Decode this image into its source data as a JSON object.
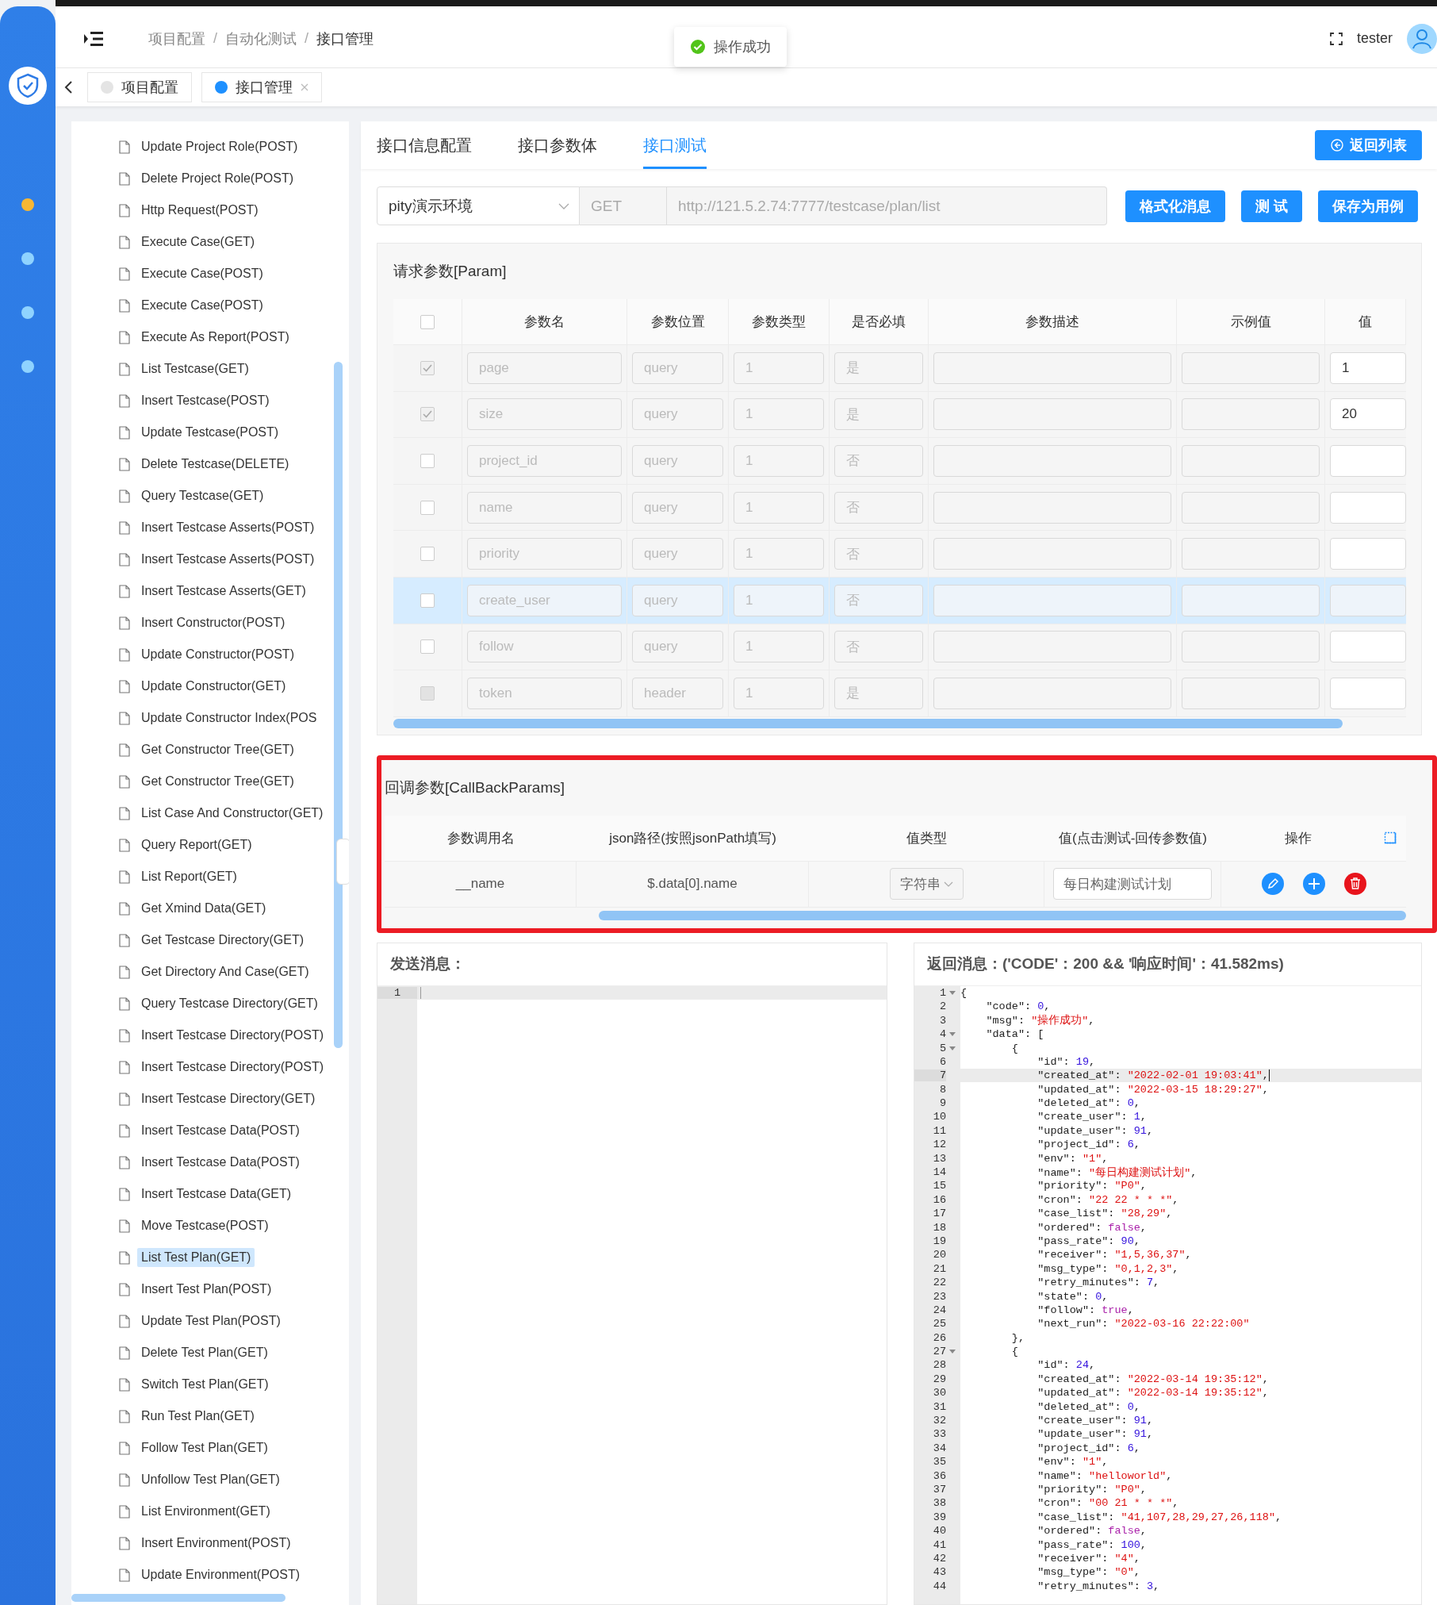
{
  "rail": {
    "items": [
      {
        "color": "#f7b733"
      },
      {
        "color": "#8fd3ff"
      },
      {
        "color": "#8fd3ff"
      },
      {
        "color": "#8fd3ff"
      }
    ]
  },
  "header": {
    "breadcrumb": [
      "项目配置",
      "自动化测试",
      "接口管理"
    ],
    "separator": "/",
    "toast": "操作成功",
    "user": "tester"
  },
  "tags": [
    {
      "label": "项目配置",
      "selected": false
    },
    {
      "label": "接口管理",
      "selected": true
    }
  ],
  "sidebar": {
    "items": [
      {
        "label": "Update Project Role(POST)",
        "selected": false
      },
      {
        "label": "Delete Project Role(POST)",
        "selected": false
      },
      {
        "label": "Http Request(POST)",
        "selected": false
      },
      {
        "label": "Execute Case(GET)",
        "selected": false
      },
      {
        "label": "Execute Case(POST)",
        "selected": false
      },
      {
        "label": "Execute Case(POST)",
        "selected": false
      },
      {
        "label": "Execute As Report(POST)",
        "selected": false
      },
      {
        "label": "List Testcase(GET)",
        "selected": false
      },
      {
        "label": "Insert Testcase(POST)",
        "selected": false
      },
      {
        "label": "Update Testcase(POST)",
        "selected": false
      },
      {
        "label": "Delete Testcase(DELETE)",
        "selected": false
      },
      {
        "label": "Query Testcase(GET)",
        "selected": false
      },
      {
        "label": "Insert Testcase Asserts(POST)",
        "selected": false
      },
      {
        "label": "Insert Testcase Asserts(POST)",
        "selected": false
      },
      {
        "label": "Insert Testcase Asserts(GET)",
        "selected": false
      },
      {
        "label": "Insert Constructor(POST)",
        "selected": false
      },
      {
        "label": "Update Constructor(POST)",
        "selected": false
      },
      {
        "label": "Update Constructor(GET)",
        "selected": false
      },
      {
        "label": "Update Constructor Index(POS",
        "selected": false
      },
      {
        "label": "Get Constructor Tree(GET)",
        "selected": false
      },
      {
        "label": "Get Constructor Tree(GET)",
        "selected": false
      },
      {
        "label": "List Case And Constructor(GET)",
        "selected": false
      },
      {
        "label": "Query Report(GET)",
        "selected": false
      },
      {
        "label": "List Report(GET)",
        "selected": false
      },
      {
        "label": "Get Xmind Data(GET)",
        "selected": false
      },
      {
        "label": "Get Testcase Directory(GET)",
        "selected": false
      },
      {
        "label": "Get Directory And Case(GET)",
        "selected": false
      },
      {
        "label": "Query Testcase Directory(GET)",
        "selected": false
      },
      {
        "label": "Insert Testcase Directory(POST)",
        "selected": false
      },
      {
        "label": "Insert Testcase Directory(POST)",
        "selected": false
      },
      {
        "label": "Insert Testcase Directory(GET)",
        "selected": false
      },
      {
        "label": "Insert Testcase Data(POST)",
        "selected": false
      },
      {
        "label": "Insert Testcase Data(POST)",
        "selected": false
      },
      {
        "label": "Insert Testcase Data(GET)",
        "selected": false
      },
      {
        "label": "Move Testcase(POST)",
        "selected": false
      },
      {
        "label": "List Test Plan(GET)",
        "selected": true
      },
      {
        "label": "Insert Test Plan(POST)",
        "selected": false
      },
      {
        "label": "Update Test Plan(POST)",
        "selected": false
      },
      {
        "label": "Delete Test Plan(GET)",
        "selected": false
      },
      {
        "label": "Switch Test Plan(GET)",
        "selected": false
      },
      {
        "label": "Run Test Plan(GET)",
        "selected": false
      },
      {
        "label": "Follow Test Plan(GET)",
        "selected": false
      },
      {
        "label": "Unfollow Test Plan(GET)",
        "selected": false
      },
      {
        "label": "List Environment(GET)",
        "selected": false
      },
      {
        "label": "Insert Environment(POST)",
        "selected": false
      },
      {
        "label": "Update Environment(POST)",
        "selected": false
      }
    ]
  },
  "tabs": [
    {
      "label": "接口信息配置",
      "selected": false
    },
    {
      "label": "接口参数体",
      "selected": false
    },
    {
      "label": "接口测试",
      "selected": true
    }
  ],
  "back_button": "返回列表",
  "request": {
    "env": "pity演示环境",
    "method": "GET",
    "url": "http://121.5.2.74:7777/testcase/plan/list",
    "buttons": [
      "格式化消息",
      "测 试",
      "保存为用例"
    ]
  },
  "params": {
    "title": "请求参数[Param]",
    "header_checked": false,
    "columns": [
      "参数名",
      "参数位置",
      "参数类型",
      "是否必填",
      "参数描述",
      "示例值",
      "值"
    ],
    "rows": [
      {
        "checked": true,
        "disabled": false,
        "hovered": false,
        "name": "page",
        "location": "query",
        "type": "1",
        "required": "是",
        "value": "1"
      },
      {
        "checked": true,
        "disabled": false,
        "hovered": false,
        "name": "size",
        "location": "query",
        "type": "1",
        "required": "是",
        "value": "20"
      },
      {
        "checked": false,
        "disabled": false,
        "hovered": false,
        "name": "project_id",
        "location": "query",
        "type": "1",
        "required": "否"
      },
      {
        "checked": false,
        "disabled": false,
        "hovered": false,
        "name": "name",
        "location": "query",
        "type": "1",
        "required": "否"
      },
      {
        "checked": false,
        "disabled": false,
        "hovered": false,
        "name": "priority",
        "location": "query",
        "type": "1",
        "required": "否"
      },
      {
        "checked": false,
        "disabled": false,
        "hovered": true,
        "name": "create_user",
        "location": "query",
        "type": "1",
        "required": "否"
      },
      {
        "checked": false,
        "disabled": false,
        "hovered": false,
        "name": "follow",
        "location": "query",
        "type": "1",
        "required": "否"
      },
      {
        "checked": false,
        "disabled": true,
        "hovered": false,
        "name": "token",
        "location": "header",
        "type": "1",
        "required": "是"
      }
    ]
  },
  "callback": {
    "title": "回调参数[CallBackParams]",
    "columns": [
      "参数调用名",
      "json路径(按照jsonPath填写)",
      "值类型",
      "值(点击测试-回传参数值)",
      "操作"
    ],
    "rows": [
      {
        "name": "__name",
        "path": "$.data[0].name",
        "type": "字符串",
        "value": "每日构建测试计划"
      }
    ]
  },
  "send": {
    "title": "发送消息：",
    "lines": [
      "1"
    ]
  },
  "response": {
    "title": "返回消息：('CODE'：200 && '响应时间'：41.582ms)",
    "lines": [
      {
        "n": "1",
        "fold": true,
        "current": false,
        "parts": [
          {
            "kind": "plain",
            "text": "{"
          }
        ]
      },
      {
        "n": "2",
        "fold": false,
        "current": false,
        "parts": [
          {
            "kind": "plain",
            "text": "    \"code\": "
          },
          {
            "kind": "number",
            "text": "0"
          },
          {
            "kind": "plain",
            "text": ","
          }
        ]
      },
      {
        "n": "3",
        "fold": false,
        "current": false,
        "parts": [
          {
            "kind": "plain",
            "text": "    \"msg\": "
          },
          {
            "kind": "string",
            "text": "\"操作成功\""
          },
          {
            "kind": "plain",
            "text": ","
          }
        ]
      },
      {
        "n": "4",
        "fold": true,
        "current": false,
        "parts": [
          {
            "kind": "plain",
            "text": "    \"data\": ["
          }
        ]
      },
      {
        "n": "5",
        "fold": true,
        "current": false,
        "parts": [
          {
            "kind": "plain",
            "text": "        {"
          }
        ]
      },
      {
        "n": "6",
        "fold": false,
        "current": false,
        "parts": [
          {
            "kind": "plain",
            "text": "            \"id\": "
          },
          {
            "kind": "number",
            "text": "19"
          },
          {
            "kind": "plain",
            "text": ","
          }
        ]
      },
      {
        "n": "7",
        "fold": false,
        "current": true,
        "parts": [
          {
            "kind": "plain",
            "text": "            \"created_at\": "
          },
          {
            "kind": "string",
            "text": "\"2022-02-01 19:03:41\""
          },
          {
            "kind": "plain",
            "text": ","
          }
        ]
      },
      {
        "n": "8",
        "fold": false,
        "current": false,
        "parts": [
          {
            "kind": "plain",
            "text": "            \"updated_at\": "
          },
          {
            "kind": "string",
            "text": "\"2022-03-15 18:29:27\""
          },
          {
            "kind": "plain",
            "text": ","
          }
        ]
      },
      {
        "n": "9",
        "fold": false,
        "current": false,
        "parts": [
          {
            "kind": "plain",
            "text": "            \"deleted_at\": "
          },
          {
            "kind": "number",
            "text": "0"
          },
          {
            "kind": "plain",
            "text": ","
          }
        ]
      },
      {
        "n": "10",
        "fold": false,
        "current": false,
        "parts": [
          {
            "kind": "plain",
            "text": "            \"create_user\": "
          },
          {
            "kind": "number",
            "text": "1"
          },
          {
            "kind": "plain",
            "text": ","
          }
        ]
      },
      {
        "n": "11",
        "fold": false,
        "current": false,
        "parts": [
          {
            "kind": "plain",
            "text": "            \"update_user\": "
          },
          {
            "kind": "number",
            "text": "91"
          },
          {
            "kind": "plain",
            "text": ","
          }
        ]
      },
      {
        "n": "12",
        "fold": false,
        "current": false,
        "parts": [
          {
            "kind": "plain",
            "text": "            \"project_id\": "
          },
          {
            "kind": "number",
            "text": "6"
          },
          {
            "kind": "plain",
            "text": ","
          }
        ]
      },
      {
        "n": "13",
        "fold": false,
        "current": false,
        "parts": [
          {
            "kind": "plain",
            "text": "            \"env\": "
          },
          {
            "kind": "string",
            "text": "\"1\""
          },
          {
            "kind": "plain",
            "text": ","
          }
        ]
      },
      {
        "n": "14",
        "fold": false,
        "current": false,
        "parts": [
          {
            "kind": "plain",
            "text": "            \"name\": "
          },
          {
            "kind": "string",
            "text": "\"每日构建测试计划\""
          },
          {
            "kind": "plain",
            "text": ","
          }
        ]
      },
      {
        "n": "15",
        "fold": false,
        "current": false,
        "parts": [
          {
            "kind": "plain",
            "text": "            \"priority\": "
          },
          {
            "kind": "string",
            "text": "\"P0\""
          },
          {
            "kind": "plain",
            "text": ","
          }
        ]
      },
      {
        "n": "16",
        "fold": false,
        "current": false,
        "parts": [
          {
            "kind": "plain",
            "text": "            \"cron\": "
          },
          {
            "kind": "string",
            "text": "\"22 22 * * *\""
          },
          {
            "kind": "plain",
            "text": ","
          }
        ]
      },
      {
        "n": "17",
        "fold": false,
        "current": false,
        "parts": [
          {
            "kind": "plain",
            "text": "            \"case_list\": "
          },
          {
            "kind": "string",
            "text": "\"28,29\""
          },
          {
            "kind": "plain",
            "text": ","
          }
        ]
      },
      {
        "n": "18",
        "fold": false,
        "current": false,
        "parts": [
          {
            "kind": "plain",
            "text": "            \"ordered\": "
          },
          {
            "kind": "boolean",
            "text": "false"
          },
          {
            "kind": "plain",
            "text": ","
          }
        ]
      },
      {
        "n": "19",
        "fold": false,
        "current": false,
        "parts": [
          {
            "kind": "plain",
            "text": "            \"pass_rate\": "
          },
          {
            "kind": "number",
            "text": "90"
          },
          {
            "kind": "plain",
            "text": ","
          }
        ]
      },
      {
        "n": "20",
        "fold": false,
        "current": false,
        "parts": [
          {
            "kind": "plain",
            "text": "            \"receiver\": "
          },
          {
            "kind": "string",
            "text": "\"1,5,36,37\""
          },
          {
            "kind": "plain",
            "text": ","
          }
        ]
      },
      {
        "n": "21",
        "fold": false,
        "current": false,
        "parts": [
          {
            "kind": "plain",
            "text": "            \"msg_type\": "
          },
          {
            "kind": "string",
            "text": "\"0,1,2,3\""
          },
          {
            "kind": "plain",
            "text": ","
          }
        ]
      },
      {
        "n": "22",
        "fold": false,
        "current": false,
        "parts": [
          {
            "kind": "plain",
            "text": "            \"retry_minutes\": "
          },
          {
            "kind": "number",
            "text": "7"
          },
          {
            "kind": "plain",
            "text": ","
          }
        ]
      },
      {
        "n": "23",
        "fold": false,
        "current": false,
        "parts": [
          {
            "kind": "plain",
            "text": "            \"state\": "
          },
          {
            "kind": "number",
            "text": "0"
          },
          {
            "kind": "plain",
            "text": ","
          }
        ]
      },
      {
        "n": "24",
        "fold": false,
        "current": false,
        "parts": [
          {
            "kind": "plain",
            "text": "            \"follow\": "
          },
          {
            "kind": "boolean",
            "text": "true"
          },
          {
            "kind": "plain",
            "text": ","
          }
        ]
      },
      {
        "n": "25",
        "fold": false,
        "current": false,
        "parts": [
          {
            "kind": "plain",
            "text": "            \"next_run\": "
          },
          {
            "kind": "string",
            "text": "\"2022-03-16 22:22:00\""
          }
        ]
      },
      {
        "n": "26",
        "fold": false,
        "current": false,
        "parts": [
          {
            "kind": "plain",
            "text": "        },"
          }
        ]
      },
      {
        "n": "27",
        "fold": true,
        "current": false,
        "parts": [
          {
            "kind": "plain",
            "text": "        {"
          }
        ]
      },
      {
        "n": "28",
        "fold": false,
        "current": false,
        "parts": [
          {
            "kind": "plain",
            "text": "            \"id\": "
          },
          {
            "kind": "number",
            "text": "24"
          },
          {
            "kind": "plain",
            "text": ","
          }
        ]
      },
      {
        "n": "29",
        "fold": false,
        "current": false,
        "parts": [
          {
            "kind": "plain",
            "text": "            \"created_at\": "
          },
          {
            "kind": "string",
            "text": "\"2022-03-14 19:35:12\""
          },
          {
            "kind": "plain",
            "text": ","
          }
        ]
      },
      {
        "n": "30",
        "fold": false,
        "current": false,
        "parts": [
          {
            "kind": "plain",
            "text": "            \"updated_at\": "
          },
          {
            "kind": "string",
            "text": "\"2022-03-14 19:35:12\""
          },
          {
            "kind": "plain",
            "text": ","
          }
        ]
      },
      {
        "n": "31",
        "fold": false,
        "current": false,
        "parts": [
          {
            "kind": "plain",
            "text": "            \"deleted_at\": "
          },
          {
            "kind": "number",
            "text": "0"
          },
          {
            "kind": "plain",
            "text": ","
          }
        ]
      },
      {
        "n": "32",
        "fold": false,
        "current": false,
        "parts": [
          {
            "kind": "plain",
            "text": "            \"create_user\": "
          },
          {
            "kind": "number",
            "text": "91"
          },
          {
            "kind": "plain",
            "text": ","
          }
        ]
      },
      {
        "n": "33",
        "fold": false,
        "current": false,
        "parts": [
          {
            "kind": "plain",
            "text": "            \"update_user\": "
          },
          {
            "kind": "number",
            "text": "91"
          },
          {
            "kind": "plain",
            "text": ","
          }
        ]
      },
      {
        "n": "34",
        "fold": false,
        "current": false,
        "parts": [
          {
            "kind": "plain",
            "text": "            \"project_id\": "
          },
          {
            "kind": "number",
            "text": "6"
          },
          {
            "kind": "plain",
            "text": ","
          }
        ]
      },
      {
        "n": "35",
        "fold": false,
        "current": false,
        "parts": [
          {
            "kind": "plain",
            "text": "            \"env\": "
          },
          {
            "kind": "string",
            "text": "\"1\""
          },
          {
            "kind": "plain",
            "text": ","
          }
        ]
      },
      {
        "n": "36",
        "fold": false,
        "current": false,
        "parts": [
          {
            "kind": "plain",
            "text": "            \"name\": "
          },
          {
            "kind": "string",
            "text": "\"helloworld\""
          },
          {
            "kind": "plain",
            "text": ","
          }
        ]
      },
      {
        "n": "37",
        "fold": false,
        "current": false,
        "parts": [
          {
            "kind": "plain",
            "text": "            \"priority\": "
          },
          {
            "kind": "string",
            "text": "\"P0\""
          },
          {
            "kind": "plain",
            "text": ","
          }
        ]
      },
      {
        "n": "38",
        "fold": false,
        "current": false,
        "parts": [
          {
            "kind": "plain",
            "text": "            \"cron\": "
          },
          {
            "kind": "string",
            "text": "\"00 21 * * *\""
          },
          {
            "kind": "plain",
            "text": ","
          }
        ]
      },
      {
        "n": "39",
        "fold": false,
        "current": false,
        "parts": [
          {
            "kind": "plain",
            "text": "            \"case_list\": "
          },
          {
            "kind": "string",
            "text": "\"41,107,28,29,27,26,118\""
          },
          {
            "kind": "plain",
            "text": ","
          }
        ]
      },
      {
        "n": "40",
        "fold": false,
        "current": false,
        "parts": [
          {
            "kind": "plain",
            "text": "            \"ordered\": "
          },
          {
            "kind": "boolean",
            "text": "false"
          },
          {
            "kind": "plain",
            "text": ","
          }
        ]
      },
      {
        "n": "41",
        "fold": false,
        "current": false,
        "parts": [
          {
            "kind": "plain",
            "text": "            \"pass_rate\": "
          },
          {
            "kind": "number",
            "text": "100"
          },
          {
            "kind": "plain",
            "text": ","
          }
        ]
      },
      {
        "n": "42",
        "fold": false,
        "current": false,
        "parts": [
          {
            "kind": "plain",
            "text": "            \"receiver\": "
          },
          {
            "kind": "string",
            "text": "\"4\""
          },
          {
            "kind": "plain",
            "text": ","
          }
        ]
      },
      {
        "n": "43",
        "fold": false,
        "current": false,
        "parts": [
          {
            "kind": "plain",
            "text": "            \"msg_type\": "
          },
          {
            "kind": "string",
            "text": "\"0\""
          },
          {
            "kind": "plain",
            "text": ","
          }
        ]
      },
      {
        "n": "44",
        "fold": false,
        "current": false,
        "parts": [
          {
            "kind": "plain",
            "text": "            \"retry_minutes\": "
          },
          {
            "kind": "number",
            "text": "3"
          },
          {
            "kind": "plain",
            "text": ","
          }
        ]
      }
    ]
  }
}
